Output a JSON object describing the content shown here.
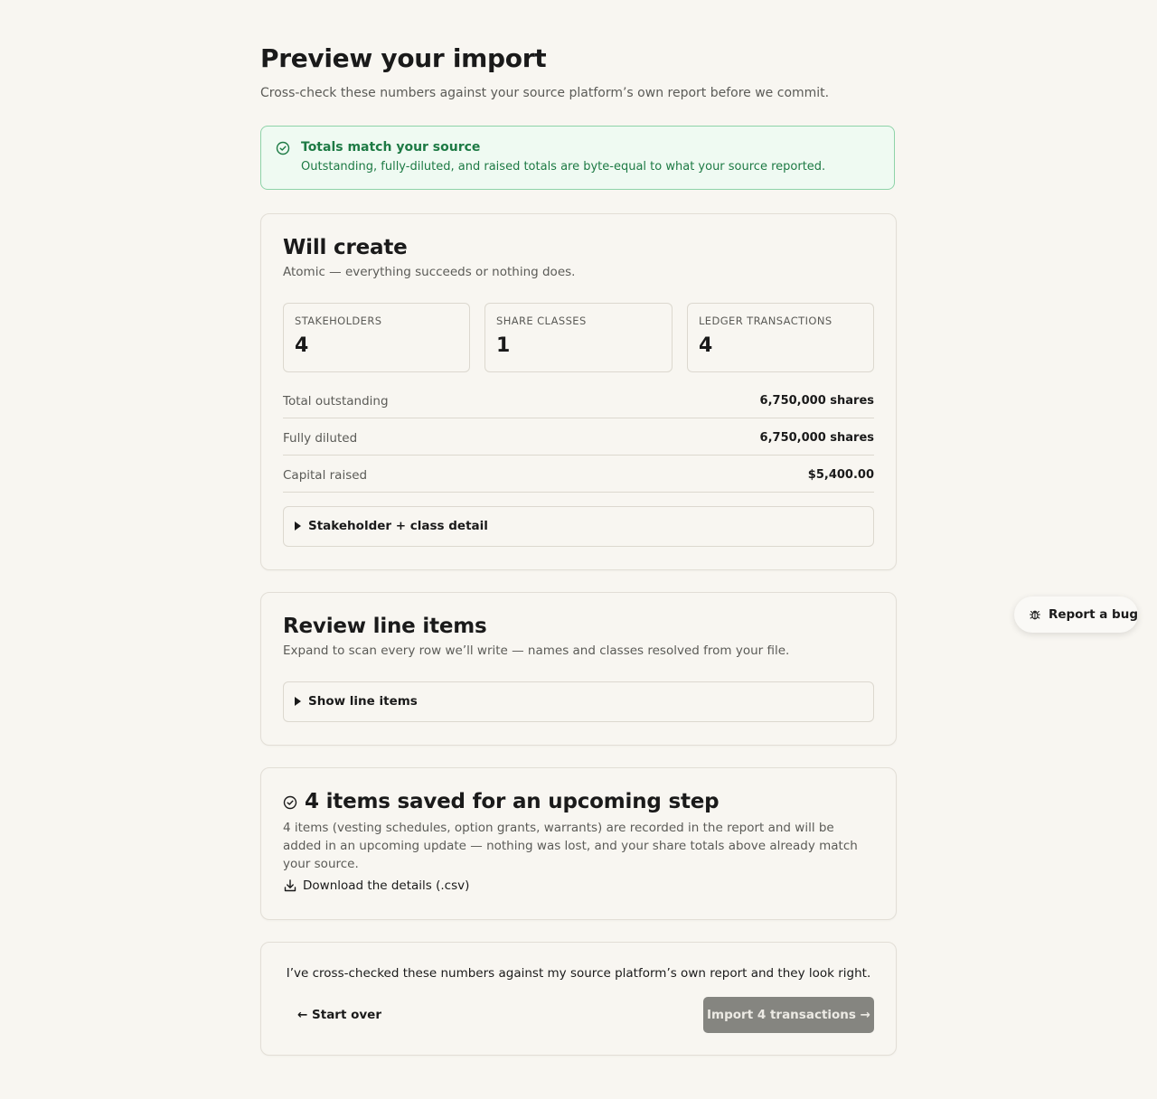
{
  "page": {
    "title": "Preview your import",
    "subtitle": "Cross-check these numbers against your source platform’s own report before we commit."
  },
  "banner": {
    "title": "Totals match your source",
    "description": "Outstanding, fully-diluted, and raised totals are byte-equal to what your source reported.",
    "color": "#1d7a44"
  },
  "will_create": {
    "title": "Will create",
    "subtitle": "Atomic — everything succeeds or nothing does.",
    "stats": [
      {
        "label": "STAKEHOLDERS",
        "value": "4"
      },
      {
        "label": "SHARE CLASSES",
        "value": "1"
      },
      {
        "label": "LEDGER TRANSACTIONS",
        "value": "4"
      }
    ],
    "rows": [
      {
        "label": "Total outstanding",
        "value": "6,750,000 shares"
      },
      {
        "label": "Fully diluted",
        "value": "6,750,000 shares"
      },
      {
        "label": "Capital raised",
        "value": "$5,400.00"
      }
    ],
    "detail_toggle": "Stakeholder + class detail"
  },
  "review": {
    "title": "Review line items",
    "subtitle": "Expand to scan every row we’ll write — names and classes resolved from your file.",
    "toggle": "Show line items"
  },
  "saved": {
    "title": "4 items saved for an upcoming step",
    "description": "4 items (vesting schedules, option grants, warrants) are recorded in the report and will be added in an upcoming update — nothing was lost, and your share totals above already match your source.",
    "download": "Download the details (.csv)"
  },
  "confirm": {
    "text": "I’ve cross-checked these numbers against my source platform’s own report and they look right.",
    "back": "← Start over",
    "import": "Import 4 transactions →"
  },
  "bug_button": "Report a bug",
  "icons": [
    "check-circle-icon",
    "triangle-right-icon",
    "download-icon",
    "bug-icon"
  ]
}
